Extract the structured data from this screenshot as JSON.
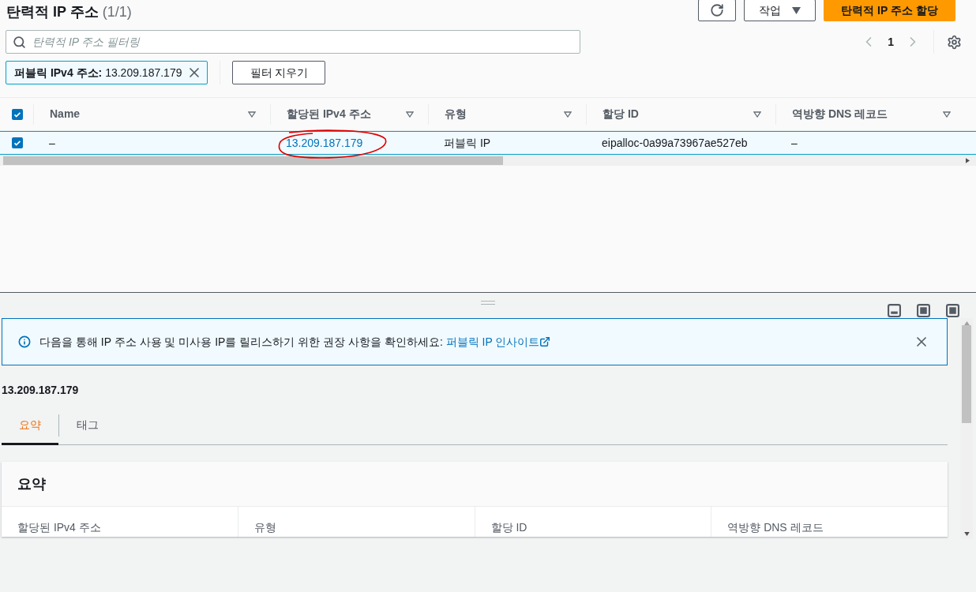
{
  "header": {
    "title": "탄력적 IP 주소",
    "count": "(1/1)",
    "actions_label": "작업",
    "primary_button": "탄력적 IP 주소 할당"
  },
  "search": {
    "placeholder": "탄력적 IP 주소 필터링"
  },
  "pagination": {
    "page": "1"
  },
  "filter_chip": {
    "label": "**퍼블릭 IPv4 주소:** 13.209.187.179"
  },
  "clear_filters": "필터 지우기",
  "table": {
    "all_checked": true,
    "columns": [
      "Name",
      "할당된 IPv4 주소",
      "유형",
      "할당 ID",
      "역방향 DNS 레코드"
    ],
    "rows": [
      {
        "checked": true,
        "selected": true,
        "cells": [
          "–",
          "13.209.187.179",
          "퍼블릭 IP",
          "eipalloc-0a99a73967ae527eb",
          "–"
        ],
        "ip_circled": true
      }
    ]
  },
  "banner": {
    "text": "다음을 통해 IP 주소 사용 및 미사용 IP를 릴리스하기 위한 권장 사항을 확인하세요: ",
    "link": "퍼블릭 IP 인사이트"
  },
  "detail": {
    "title": "13.209.187.179",
    "tabs": [
      {
        "label": "요약",
        "selected": true
      },
      {
        "label": "태그",
        "selected": false
      }
    ],
    "card_title": "요약",
    "fields": [
      "할당된 IPv4 주소",
      "유형",
      "할당 ID",
      "역방향 DNS 레코드"
    ]
  }
}
